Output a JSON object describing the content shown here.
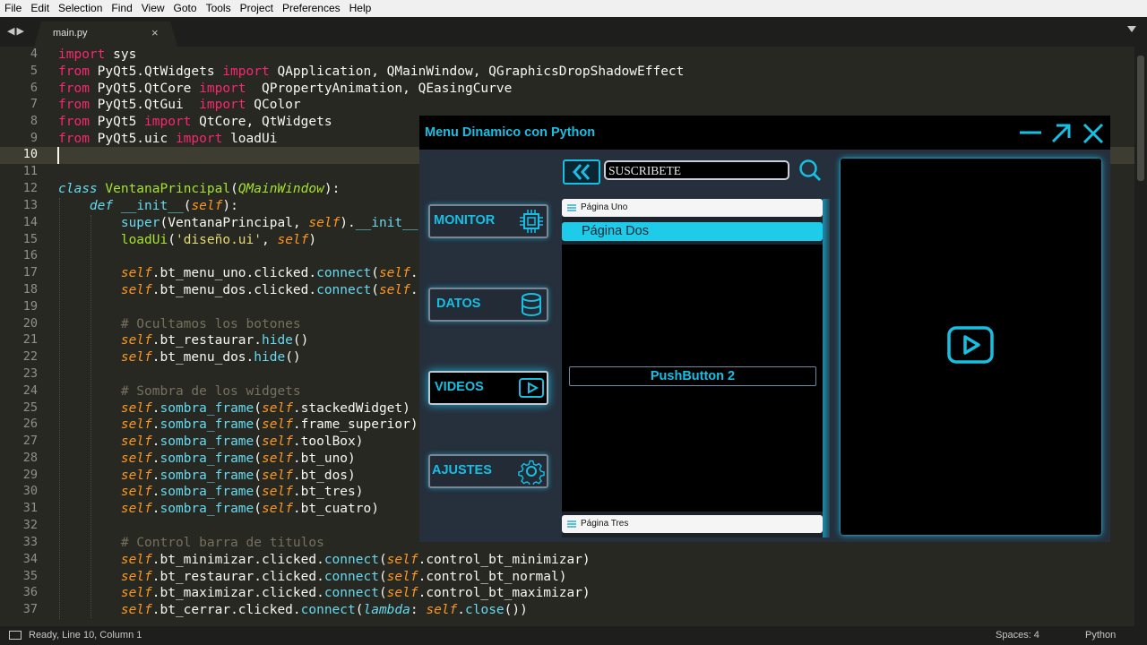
{
  "menubar": [
    "File",
    "Edit",
    "Selection",
    "Find",
    "View",
    "Goto",
    "Tools",
    "Project",
    "Preferences",
    "Help"
  ],
  "tab": {
    "name": "main.py",
    "close": "×"
  },
  "nav_arrows": "◀▶",
  "current_line": 10,
  "line_numbers": [
    "4",
    "5",
    "6",
    "7",
    "8",
    "9",
    "10",
    "11",
    "12",
    "13",
    "14",
    "15",
    "16",
    "17",
    "18",
    "19",
    "20",
    "21",
    "22",
    "23",
    "24",
    "25",
    "26",
    "27",
    "28",
    "29",
    "30",
    "31",
    "32",
    "33",
    "34",
    "35",
    "36",
    "37"
  ],
  "status": {
    "left": "Ready, Line 10, Column 1",
    "spaces": "Spaces: 4",
    "syntax": "Python"
  },
  "app": {
    "title": "Menu  Dinamico con Python",
    "search_value": "SUSCRIBETE",
    "nav": [
      {
        "label": "MONITOR",
        "icon": "cpu-icon"
      },
      {
        "label": "DATOS",
        "icon": "database-icon"
      },
      {
        "label": "VIDEOS",
        "icon": "play-icon"
      },
      {
        "label": "AJUSTES",
        "icon": "gear-icon"
      }
    ],
    "toolbox": {
      "page1": "Página  Uno",
      "page2": "Página Dos",
      "page3": "Página  Tres"
    },
    "pushbutton": "PushButton 2",
    "colors": {
      "accent": "#17bfe3",
      "panel": "#262f3c",
      "black": "#000000"
    }
  }
}
